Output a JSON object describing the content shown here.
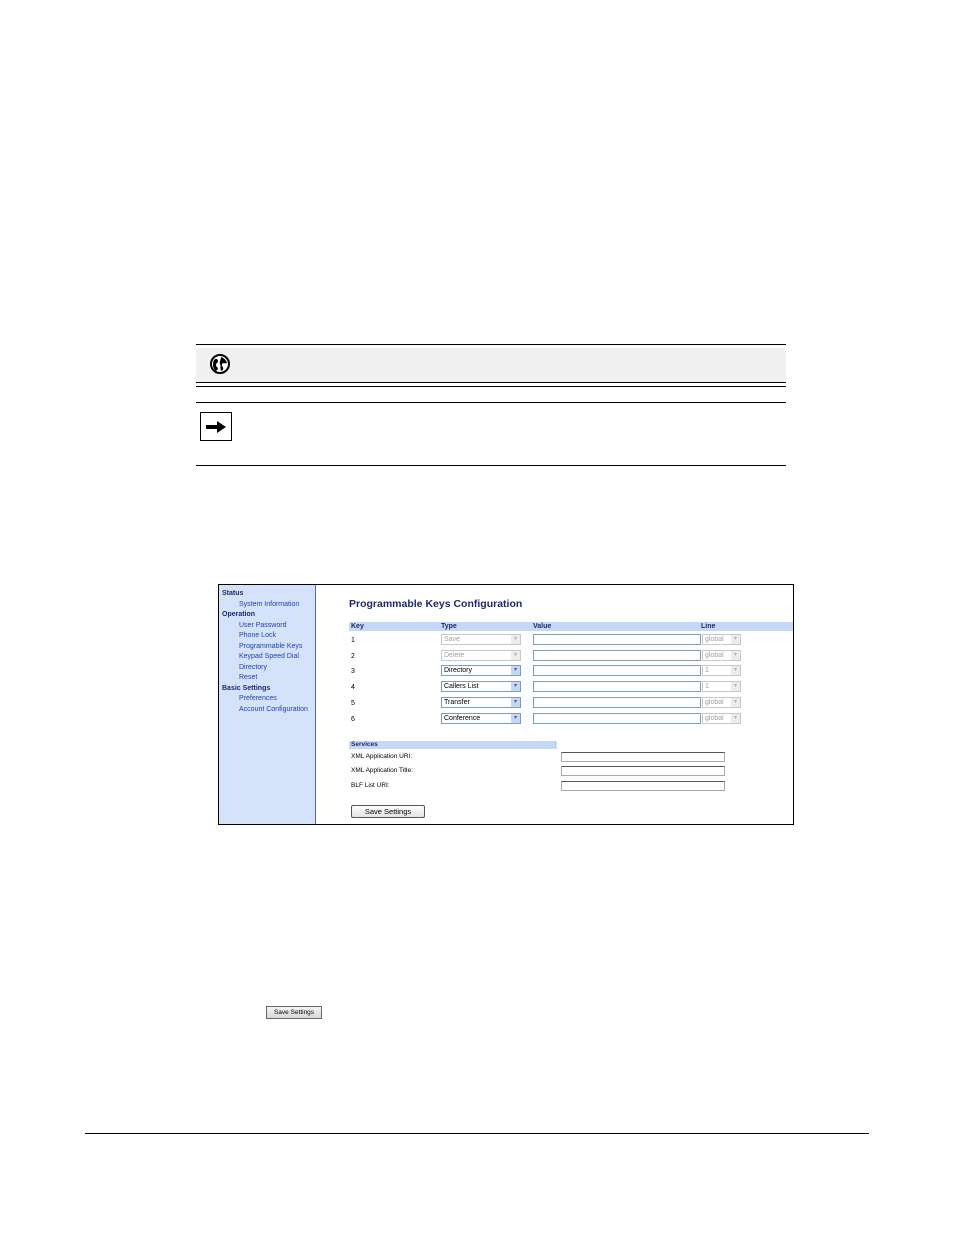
{
  "sidebar": {
    "groups": [
      {
        "heading": "Status",
        "items": [
          "System Information"
        ]
      },
      {
        "heading": "Operation",
        "items": [
          "User Password",
          "Phone Lock",
          "Programmable Keys",
          "Keypad Speed Dial",
          "Directory",
          "Reset"
        ]
      },
      {
        "heading": "Basic Settings",
        "items": [
          "Preferences",
          "Account Configuration"
        ]
      }
    ]
  },
  "page": {
    "title": "Programmable Keys Configuration",
    "columns": {
      "key": "Key",
      "type": "Type",
      "value": "Value",
      "line": "Line"
    },
    "rows": [
      {
        "key": "1",
        "type": "Save",
        "type_enabled": false,
        "value": "",
        "line": "global",
        "line_enabled": false
      },
      {
        "key": "2",
        "type": "Delete",
        "type_enabled": false,
        "value": "",
        "line": "global",
        "line_enabled": false
      },
      {
        "key": "3",
        "type": "Directory",
        "type_enabled": true,
        "value": "",
        "line": "1",
        "line_enabled": false
      },
      {
        "key": "4",
        "type": "Callers List",
        "type_enabled": true,
        "value": "",
        "line": "1",
        "line_enabled": false
      },
      {
        "key": "5",
        "type": "Transfer",
        "type_enabled": true,
        "value": "",
        "line": "global",
        "line_enabled": false
      },
      {
        "key": "6",
        "type": "Conference",
        "type_enabled": true,
        "value": "",
        "line": "global",
        "line_enabled": false
      }
    ],
    "services": {
      "heading": "Services",
      "fields": [
        {
          "label": "XML Application URI:",
          "value": ""
        },
        {
          "label": "XML Application Title:",
          "value": ""
        },
        {
          "label": "BLF List URI:",
          "value": ""
        }
      ]
    },
    "save_label": "Save Settings"
  },
  "inline_button": {
    "label": "Save Settings"
  },
  "icons": {
    "note": "globe-icon",
    "tip": "arrow-right-icon"
  }
}
